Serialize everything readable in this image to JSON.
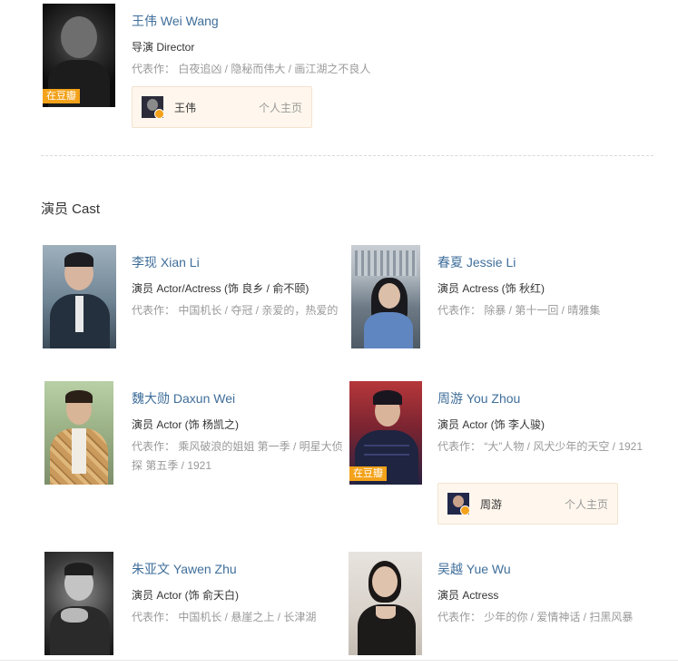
{
  "director": {
    "name": "王伟 Wei Wang",
    "role": "导演 Director",
    "works": "代表作：  白夜追凶 / 隐秘而伟大 / 画江湖之不良人",
    "badge": "在豆瓣",
    "card": {
      "name": "王伟",
      "link": "个人主页"
    }
  },
  "section": {
    "title": "演员 Cast"
  },
  "cast": [
    {
      "name": "李现 Xian Li",
      "role": "演员 Actor/Actress (饰 良乡 / 俞不颐)",
      "works": "代表作：  中国机长 / 夺冠 / 亲爱的，热爱的"
    },
    {
      "name": "春夏 Jessie Li",
      "role": "演员 Actress (饰 秋红)",
      "works": "代表作：  除暴 / 第十一回 / 晴雅集"
    },
    {
      "name": "魏大勋 Daxun Wei",
      "role": "演员 Actor (饰 杨凯之)",
      "works": "代表作：  乘风破浪的姐姐 第一季 / 明星大侦探 第五季 / 1921"
    },
    {
      "name": "周游 You Zhou",
      "role": "演员 Actor (饰 李人骏)",
      "works": "代表作：  “大”人物 / 风犬少年的天空 / 1921",
      "badge": "在豆瓣",
      "card": {
        "name": "周游",
        "link": "个人主页"
      }
    },
    {
      "name": "朱亚文 Yawen Zhu",
      "role": "演员 Actor (饰 俞天白)",
      "works": "代表作：  中国机长 / 悬崖之上 / 长津湖"
    },
    {
      "name": "吴越 Yue Wu",
      "role": "演员 Actress",
      "works": "代表作：  少年的你 / 爱情神话 / 扫黑风暴"
    }
  ],
  "colors": {
    "name_link": "#3f6e9a",
    "badge": "#f3a21a",
    "card_bg": "#fff7ed",
    "muted": "#999999"
  }
}
